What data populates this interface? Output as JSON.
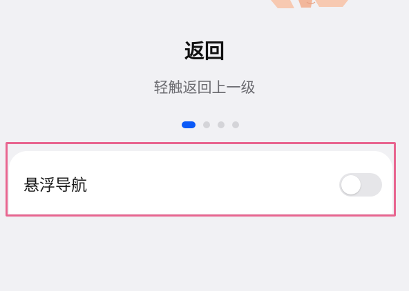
{
  "header": {
    "title": "返回",
    "subtitle": "轻触返回上一级"
  },
  "pager": {
    "page_count": 4,
    "active_index": 0,
    "active_color": "#0a59f7"
  },
  "floating_nav": {
    "label": "悬浮导航",
    "enabled": false
  },
  "colors": {
    "background": "#f1f1f4",
    "highlight_border": "#e8658f"
  }
}
